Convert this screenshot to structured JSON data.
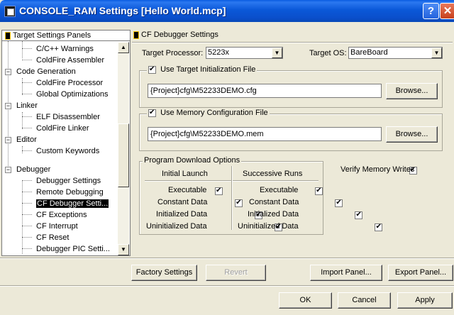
{
  "window": {
    "title": "CONSOLE_RAM Settings [Hello World.mcp]",
    "help_glyph": "?",
    "close_glyph": "✕"
  },
  "tree": {
    "header": "Target Settings Panels",
    "items": [
      {
        "label": "C/C++ Warnings"
      },
      {
        "label": "ColdFire Assembler"
      },
      {
        "label": "Code Generation",
        "expander": "−"
      },
      {
        "label": "ColdFire Processor"
      },
      {
        "label": "Global Optimizations"
      },
      {
        "label": "Linker",
        "expander": "−"
      },
      {
        "label": "ELF Disassembler"
      },
      {
        "label": "ColdFire Linker"
      },
      {
        "label": "Editor",
        "expander": "−"
      },
      {
        "label": "Custom Keywords"
      },
      {
        "label": "Debugger",
        "expander": "−"
      },
      {
        "label": "Debugger Settings"
      },
      {
        "label": "Remote Debugging"
      },
      {
        "label": "CF Debugger Setti..."
      },
      {
        "label": "CF Exceptions"
      },
      {
        "label": "CF Interrupt"
      },
      {
        "label": "CF Reset"
      },
      {
        "label": "Debugger PIC Setti..."
      }
    ],
    "scroll_up": "▲",
    "scroll_down": "▼"
  },
  "panel": {
    "header": "CF Debugger Settings",
    "target_processor_label": "Target Processor:",
    "target_processor_value": "5223x",
    "target_os_label": "Target OS:",
    "target_os_value": "BareBoard",
    "dropdown_arrow": "▼",
    "init_file": {
      "label": "Use Target Initialization File",
      "checked": true,
      "value": "{Project}cfg\\M52233DEMO.cfg",
      "browse": "Browse..."
    },
    "mem_file": {
      "label": "Use Memory Configuration File",
      "checked": true,
      "value": "{Project}cfg\\M52233DEMO.mem",
      "browse": "Browse..."
    },
    "download": {
      "legend": "Program Download Options",
      "col1_header": "Initial Launch",
      "col2_header": "Successive Runs",
      "rows": [
        {
          "label": "Executable",
          "initial": true,
          "successive": true
        },
        {
          "label": "Constant Data",
          "initial": true,
          "successive": true
        },
        {
          "label": "Initialized Data",
          "initial": true,
          "successive": true
        },
        {
          "label": "Uninitialized Data",
          "initial": true,
          "successive": true
        }
      ]
    },
    "verify_label": "Verify Memory Writes",
    "verify_checked": true
  },
  "buttons": {
    "factory": "Factory Settings",
    "revert": "Revert",
    "import": "Import Panel...",
    "export": "Export Panel...",
    "ok": "OK",
    "cancel": "Cancel",
    "apply": "Apply"
  }
}
